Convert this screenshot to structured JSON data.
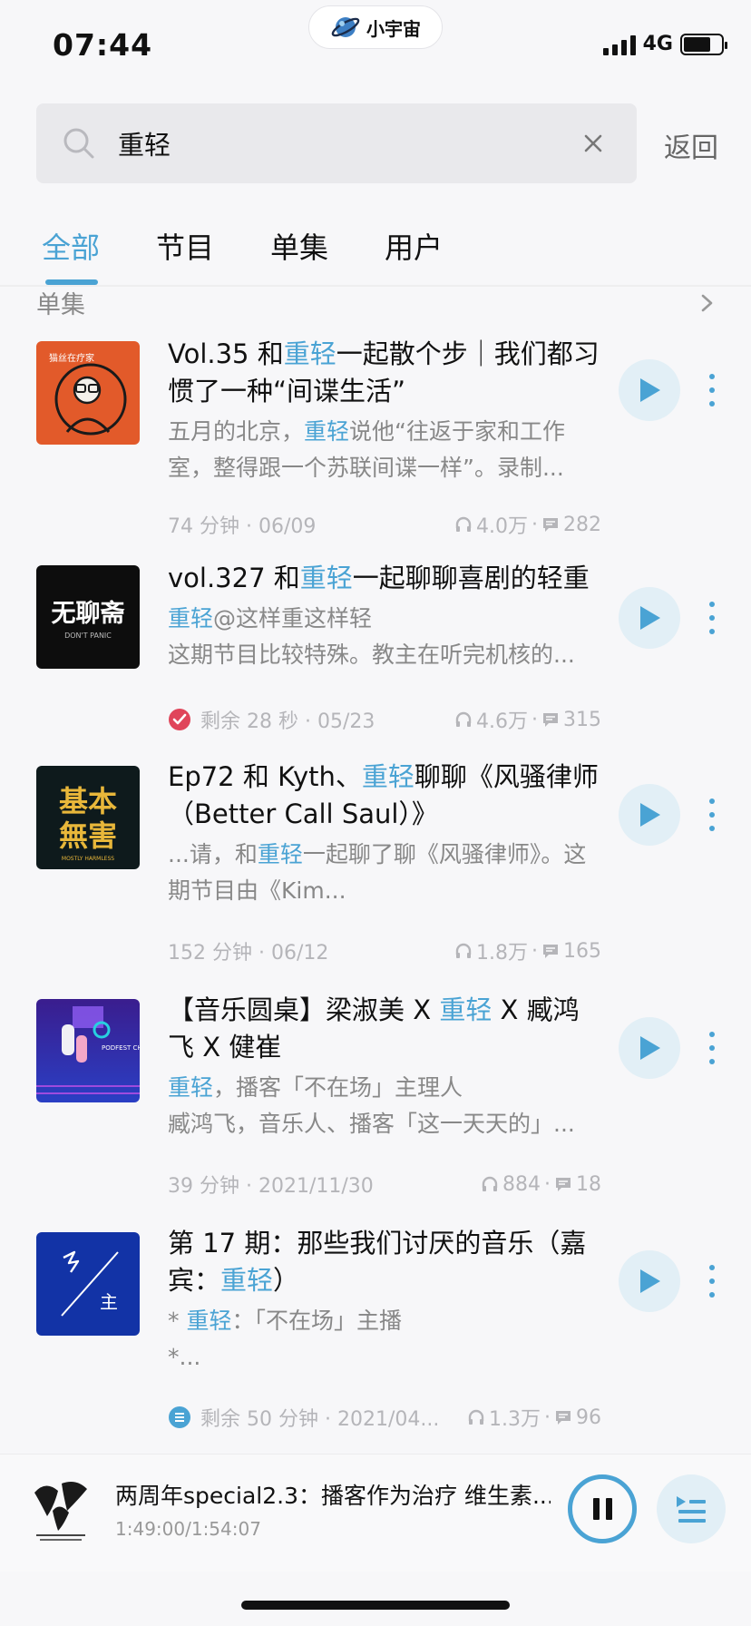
{
  "status": {
    "time": "07:44",
    "network": "4G",
    "app_name": "小宇宙"
  },
  "search": {
    "query": "重轻",
    "back_label": "返回"
  },
  "tabs": [
    {
      "label": "全部",
      "active": true
    },
    {
      "label": "节目",
      "active": false
    },
    {
      "label": "单集",
      "active": false
    },
    {
      "label": "用户",
      "active": false
    }
  ],
  "section": {
    "title": "单集"
  },
  "episodes": [
    {
      "title_a": "Vol.35 和",
      "title_hl": "重轻",
      "title_b": "一起散个步｜我们都习惯了一种“间谍生活”",
      "desc_a": "五月的北京，",
      "desc_hl": "重轻",
      "desc_b": "说他“往返于家和工作室，整得跟一个苏联间谍一样”。录制...",
      "meta_left": "74 分钟 · 06/09",
      "listens": "4.0万",
      "comments": "282"
    },
    {
      "title_a": "vol.327 和",
      "title_hl": "重轻",
      "title_b": "一起聊聊喜剧的轻重",
      "desc_a": "",
      "desc_hl": "重轻",
      "desc_b": "@这样重这样轻",
      "desc2": "这期节目比较特殊。教主在听完机核的...",
      "meta_left": "剩余 28 秒 · 05/23",
      "listens": "4.6万",
      "comments": "315"
    },
    {
      "title_a": "Ep72 和 Kyth、",
      "title_hl": "重轻",
      "title_b": "聊聊《风骚律师（Better Call Saul）》",
      "desc_a": "...请，和",
      "desc_hl": "重轻",
      "desc_b": "一起聊了聊《风骚律师》。这期节目由《Kim...",
      "meta_left": "152 分钟 · 06/12",
      "listens": "1.8万",
      "comments": "165"
    },
    {
      "title_a": "【音乐圆桌】梁淑美 X ",
      "title_hl": "重轻",
      "title_b": " X 臧鸿飞 X 健崔",
      "desc_a": "",
      "desc_hl": "重轻",
      "desc_b": "，播客「不在场」主理人",
      "desc2": "臧鸿飞，音乐人、播客「这一天天的」...",
      "meta_left": "39 分钟 · 2021/11/30",
      "listens": "884",
      "comments": "18"
    },
    {
      "title_a": "第 17 期：那些我们讨厌的音乐（嘉宾：",
      "title_hl": "重轻",
      "title_b": "）",
      "desc_a": "* ",
      "desc_hl": "重轻",
      "desc_b": "：「不在场」主播",
      "desc2": "*...",
      "meta_left": "剩余 50 分钟 · 2021/04...",
      "listens": "1.3万",
      "comments": "96"
    }
  ],
  "covers": {
    "c1_text": "猫丝在疗家",
    "c2_text": "无聊斋",
    "c2_sub": "DON'T PANIC",
    "c3_text_a": "基本",
    "c3_text_b": "無害",
    "c3_sub": "MOSTLY HARMLESS",
    "c4_text": "PODFEST CHINA",
    "c5_text": "主"
  },
  "player": {
    "title": "两周年special2.3：播客作为治疗 维生素...",
    "time": "1:49:00/1:54:07"
  },
  "colors": {
    "accent": "#4aa3d4",
    "text": "#111111",
    "muted": "#888888"
  }
}
